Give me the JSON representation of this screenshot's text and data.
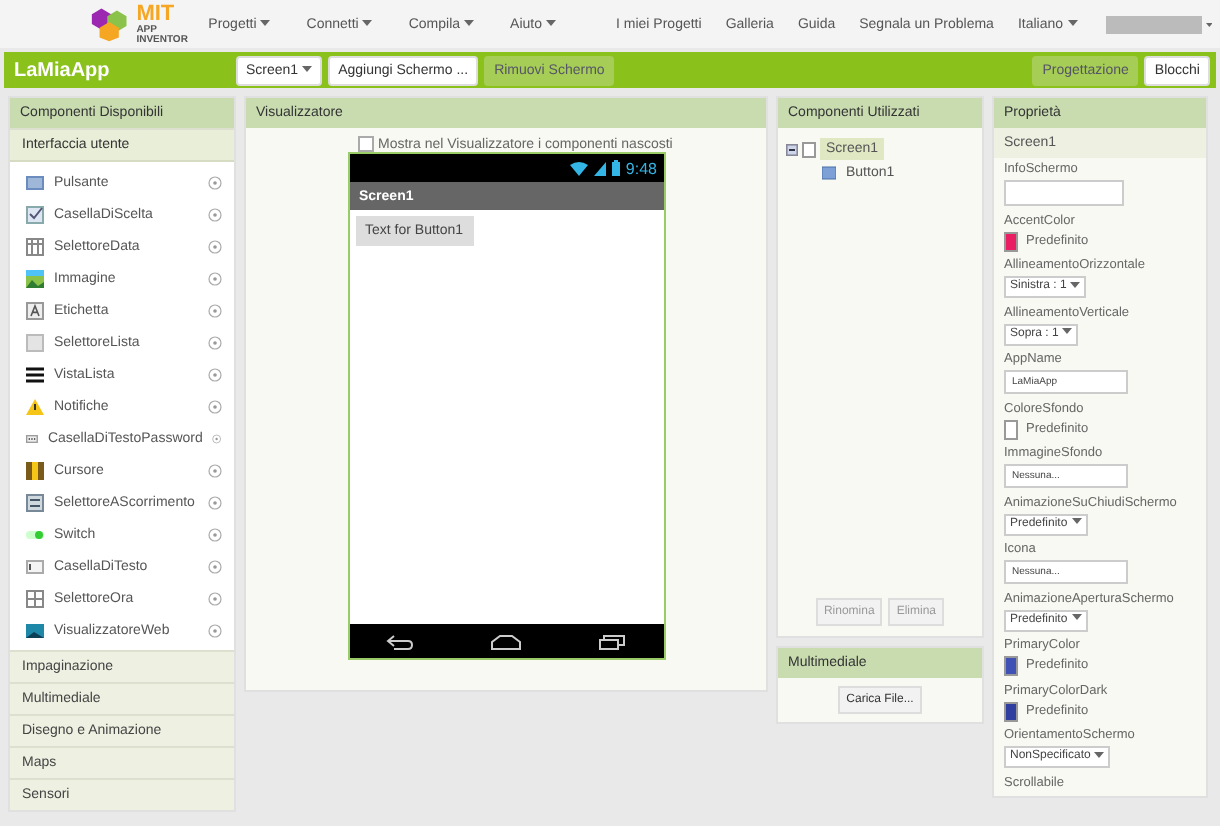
{
  "nav": {
    "logo_title": "MIT",
    "logo_subtitle": "APP INVENTOR",
    "menus": [
      "Progetti",
      "Connetti",
      "Compila",
      "Aiuto"
    ],
    "links": [
      "I miei Progetti",
      "Galleria",
      "Guida",
      "Segnala un Problema"
    ],
    "language": "Italiano"
  },
  "toolbar": {
    "project_name": "LaMiaApp",
    "screen_selector": "Screen1",
    "buttons": [
      {
        "label": "Aggiungi Schermo ...",
        "disabled": false
      },
      {
        "label": "Rimuovi Schermo",
        "disabled": true
      }
    ],
    "views": [
      {
        "label": "Progettazione",
        "selected": true
      },
      {
        "label": "Blocchi",
        "selected": false
      }
    ]
  },
  "palette": {
    "title": "Componenti Disponibili",
    "categories": [
      {
        "label": "Interfaccia utente",
        "expanded": true,
        "items": [
          {
            "label": "Pulsante",
            "kind": "button"
          },
          {
            "label": "CasellaDiScelta",
            "kind": "checkbox"
          },
          {
            "label": "SelettoreData",
            "kind": "date"
          },
          {
            "label": "Immagine",
            "kind": "image"
          },
          {
            "label": "Etichetta",
            "kind": "label"
          },
          {
            "label": "SelettoreLista",
            "kind": "list"
          },
          {
            "label": "VistaLista",
            "kind": "listview"
          },
          {
            "label": "Notifiche",
            "kind": "warning"
          },
          {
            "label": "CasellaDiTestoPassword",
            "kind": "password"
          },
          {
            "label": "Cursore",
            "kind": "slider"
          },
          {
            "label": "SelettoreAScorrimento",
            "kind": "spinner"
          },
          {
            "label": "Switch",
            "kind": "switch"
          },
          {
            "label": "CasellaDiTesto",
            "kind": "textbox"
          },
          {
            "label": "SelettoreOra",
            "kind": "time"
          },
          {
            "label": "VisualizzatoreWeb",
            "kind": "web"
          }
        ]
      },
      {
        "label": "Impaginazione",
        "expanded": false
      },
      {
        "label": "Multimediale",
        "expanded": false
      },
      {
        "label": "Disegno e Animazione",
        "expanded": false
      },
      {
        "label": "Maps",
        "expanded": false
      },
      {
        "label": "Sensori",
        "expanded": false
      }
    ]
  },
  "viewer": {
    "title": "Visualizzatore",
    "hidden_toggle": {
      "label": "Mostra nel Visualizzatore i componenti nascosti",
      "checked": false
    },
    "phone": {
      "time": "9:48",
      "title": "Screen1",
      "button": "Text for Button1"
    }
  },
  "components": {
    "title": "Componenti Utilizzati",
    "tree": [
      {
        "label": "Screen1",
        "selected": true,
        "expanded": true,
        "children": [
          {
            "label": "Button1",
            "selected": false
          }
        ]
      }
    ],
    "buttons": [
      {
        "label": "Rinomina",
        "disabled": true
      },
      {
        "label": "Elimina",
        "disabled": true
      }
    ]
  },
  "media": {
    "title": "Multimediale",
    "button": "Carica File..."
  },
  "properties": {
    "title": "Proprietà",
    "component": "Screen1",
    "items": [
      {
        "label": "InfoSchermo",
        "kind": "textarea"
      },
      {
        "label": "AccentColor",
        "kind": "color",
        "color": "#e91e63",
        "value": "Predefinito"
      },
      {
        "label": "AllineamentoOrizzontale",
        "kind": "dropdown",
        "value": "Sinistra : 1"
      },
      {
        "label": "AllineamentoVerticale",
        "kind": "dropdown",
        "value": "Sopra : 1"
      },
      {
        "label": "AppName",
        "kind": "text",
        "value": "LaMiaApp"
      },
      {
        "label": "ColoreSfondo",
        "kind": "color",
        "color": "#ffffff",
        "value": "Predefinito"
      },
      {
        "label": "ImmagineSfondo",
        "kind": "asset",
        "value": "Nessuna..."
      },
      {
        "label": "AnimazioneSuChiudiSchermo",
        "kind": "dropdown",
        "value": "Predefinito"
      },
      {
        "label": "Icona",
        "kind": "asset",
        "value": "Nessuna..."
      },
      {
        "label": "AnimazioneAperturaSchermo",
        "kind": "dropdown",
        "value": "Predefinito"
      },
      {
        "label": "PrimaryColor",
        "kind": "color",
        "color": "#3f51b5",
        "value": "Predefinito"
      },
      {
        "label": "PrimaryColorDark",
        "kind": "color",
        "color": "#303f9f",
        "value": "Predefinito"
      },
      {
        "label": "OrientamentoSchermo",
        "kind": "dropdown",
        "value": "NonSpecificato"
      },
      {
        "label": "Scrollabile",
        "kind": "label"
      }
    ]
  }
}
